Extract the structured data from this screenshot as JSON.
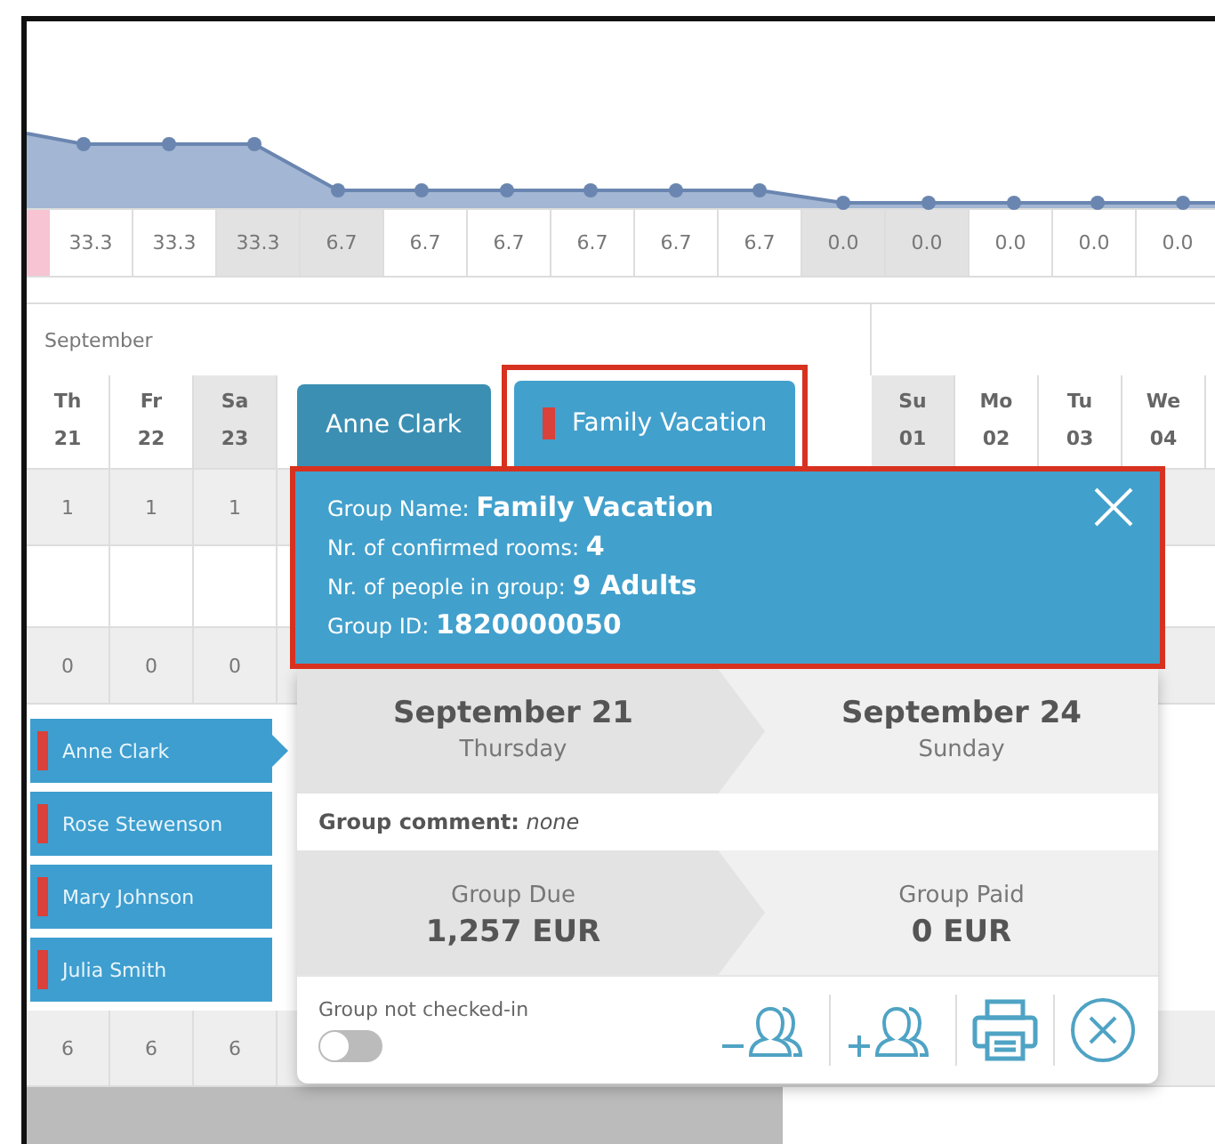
{
  "values_row": [
    {
      "text": "33.3",
      "shaded": false
    },
    {
      "text": "33.3",
      "shaded": false
    },
    {
      "text": "33.3",
      "shaded": true
    },
    {
      "text": "6.7",
      "shaded": true
    },
    {
      "text": "6.7",
      "shaded": false
    },
    {
      "text": "6.7",
      "shaded": false
    },
    {
      "text": "6.7",
      "shaded": false
    },
    {
      "text": "6.7",
      "shaded": false
    },
    {
      "text": "6.7",
      "shaded": false
    },
    {
      "text": "0.0",
      "shaded": true
    },
    {
      "text": "0.0",
      "shaded": true
    },
    {
      "text": "0.0",
      "shaded": false
    },
    {
      "text": "0.0",
      "shaded": false
    },
    {
      "text": "0.0",
      "shaded": false
    }
  ],
  "calendar": {
    "month": "September",
    "days_left": [
      {
        "weekday": "Th",
        "date": "21",
        "shaded": false
      },
      {
        "weekday": "Fr",
        "date": "22",
        "shaded": false
      },
      {
        "weekday": "Sa",
        "date": "23",
        "shaded": true
      }
    ],
    "days_right": [
      {
        "weekday": "Su",
        "date": "01",
        "shaded": true
      },
      {
        "weekday": "Mo",
        "date": "02",
        "shaded": false
      },
      {
        "weekday": "Tu",
        "date": "03",
        "shaded": false
      },
      {
        "weekday": "We",
        "date": "04",
        "shaded": false
      }
    ],
    "row_rooms": [
      "1",
      "1",
      "1"
    ],
    "row_free": [
      "0",
      "0",
      "0"
    ],
    "bookings": [
      {
        "name": "Anne Clark",
        "selected": true
      },
      {
        "name": "Rose Stewenson",
        "selected": false
      },
      {
        "name": "Mary Johnson",
        "selected": false
      },
      {
        "name": "Julia Smith",
        "selected": false
      }
    ],
    "row_total": [
      "6",
      "6",
      "6"
    ]
  },
  "popup": {
    "tabs": [
      {
        "label": "Anne Clark",
        "selected": false,
        "marker": false
      },
      {
        "label": "Family Vacation",
        "selected": true,
        "marker": true
      }
    ],
    "info": [
      {
        "label": "Group Name:",
        "value": "Family Vacation"
      },
      {
        "label": "Nr. of confirmed rooms:",
        "value": "4"
      },
      {
        "label": "Nr. of people in group:",
        "value": "9 Adults"
      },
      {
        "label": "Group ID:",
        "value": "1820000050"
      }
    ],
    "arrival": {
      "date": "September 21",
      "weekday": "Thursday"
    },
    "departure": {
      "date": "September 24",
      "weekday": "Sunday"
    },
    "comment": {
      "label": "Group comment:",
      "value": "none"
    },
    "due": {
      "label": "Group Due",
      "value": "1,257 EUR"
    },
    "paid": {
      "label": "Group Paid",
      "value": "0 EUR"
    },
    "checkin": {
      "label": "Group not checked-in",
      "on": false
    }
  }
}
